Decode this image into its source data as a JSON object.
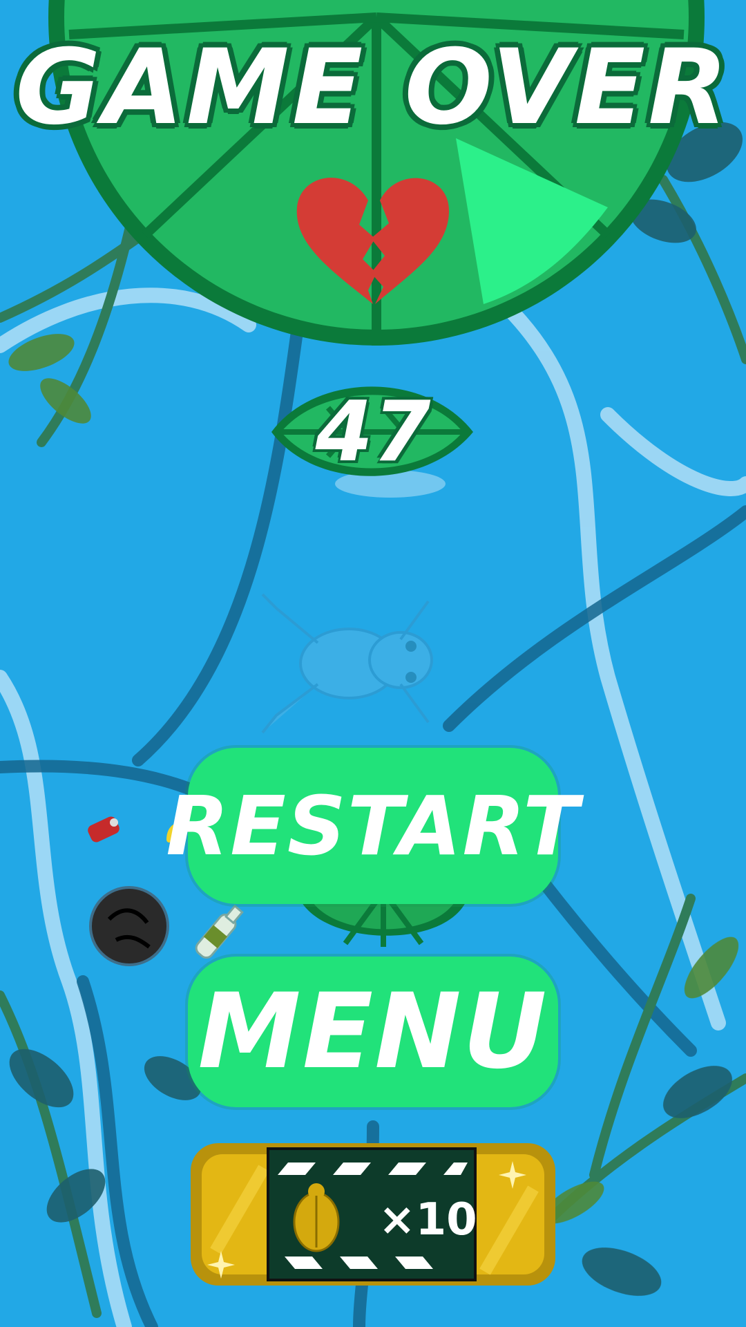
{
  "game_over": {
    "title": "GAME OVER",
    "score": "47",
    "buttons": {
      "restart_label": "RESTART",
      "menu_label": "MENU"
    },
    "reward": {
      "label": "×10",
      "icon": "golden-fly-icon"
    }
  },
  "colors": {
    "water": "#22a8e6",
    "lily_pad": "#20b85e",
    "lily_pad_dark": "#0b7a3a",
    "button_green": "#21e27a",
    "heart_red": "#d43c35",
    "gold": "#e3b714"
  },
  "icons": [
    "broken-heart-icon",
    "leaf-icon",
    "frog-icon",
    "trash-bag-icon",
    "bottle-icon",
    "can-icon",
    "golden-fly-icon"
  ]
}
